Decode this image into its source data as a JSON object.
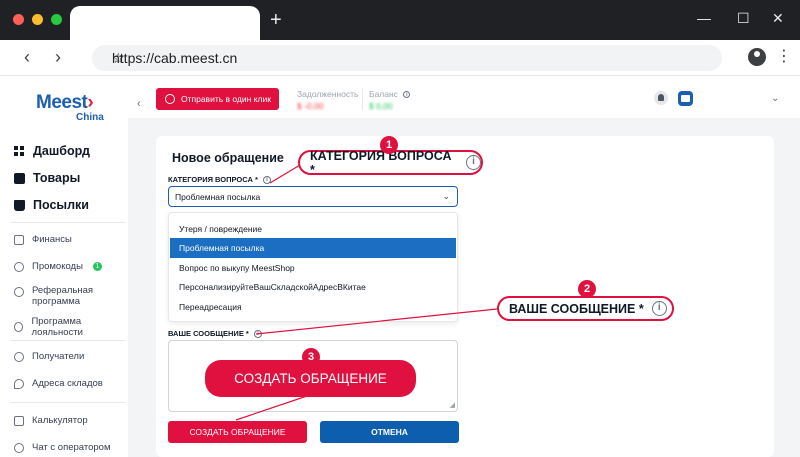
{
  "browser": {
    "url": "https://cab.meest.cn",
    "window_controls": [
      "—",
      "☐",
      "✕"
    ],
    "new_tab": "+",
    "back": "‹",
    "forward": "›",
    "star": "☆",
    "menu": "⋮"
  },
  "colors": {
    "brand_red": "#e0103f",
    "brand_blue": "#1b5fae",
    "selected_option": "#1b6ec2"
  },
  "sidebar": {
    "logo": "Meest",
    "logo_mark": "›",
    "logo_sub": "China",
    "main_items": [
      {
        "label": "Дашборд",
        "icon": "dashboard-icon"
      },
      {
        "label": "Товары",
        "icon": "box-icon"
      },
      {
        "label": "Посылки",
        "icon": "parcel-icon"
      }
    ],
    "secondary_items": [
      {
        "label": "Финансы",
        "icon": "finance-icon"
      },
      {
        "label": "Промокоды",
        "icon": "promo-icon",
        "badge": "1"
      },
      {
        "label": "Реферальная",
        "label2": "программа",
        "icon": "referral-icon"
      },
      {
        "label": "Программа лояльности",
        "icon": "loyalty-icon"
      },
      {
        "label": "Получатели",
        "icon": "recipients-icon"
      },
      {
        "label": "Адреса складов",
        "icon": "location-icon"
      },
      {
        "label": "Калькулятор",
        "icon": "calculator-icon"
      },
      {
        "label": "Чат с оператором",
        "icon": "chat-icon"
      }
    ]
  },
  "header": {
    "collapse": "‹",
    "one_click_button": "Отправить в один клик",
    "debt_label": "Задолженность",
    "debt_value": "$ -0,00",
    "balance_label": "Баланс",
    "balance_value": "$ 0,00",
    "chevron": "⌄"
  },
  "form": {
    "title": "Новое обращение",
    "category_label": "КАТЕГОРИЯ ВОПРОСА *",
    "category_selected": "Проблемная посылка",
    "category_options": [
      "Утеря / повреждение",
      "Проблемная посылка",
      "Вопрос по выкупу MeestShop",
      "ПерсонализируйтеВашСкладскойАдресВКитае",
      "Переадресация"
    ],
    "selected_index": 1,
    "message_label": "ВАШЕ СООБЩЕНИЕ *",
    "message_value": "",
    "create_button": "СОЗДАТЬ ОБРАЩЕНИЕ",
    "cancel_button": "ОТМЕНА"
  },
  "annotations": {
    "callout1_num": "1",
    "callout1_text": "КАТЕГОРИЯ ВОПРОСА *",
    "callout2_num": "2",
    "callout2_text": "ВАШЕ СООБЩЕНИЕ *",
    "callout3_num": "3",
    "callout3_text": "СОЗДАТЬ ОБРАЩЕНИЕ",
    "info_glyph": "i"
  }
}
